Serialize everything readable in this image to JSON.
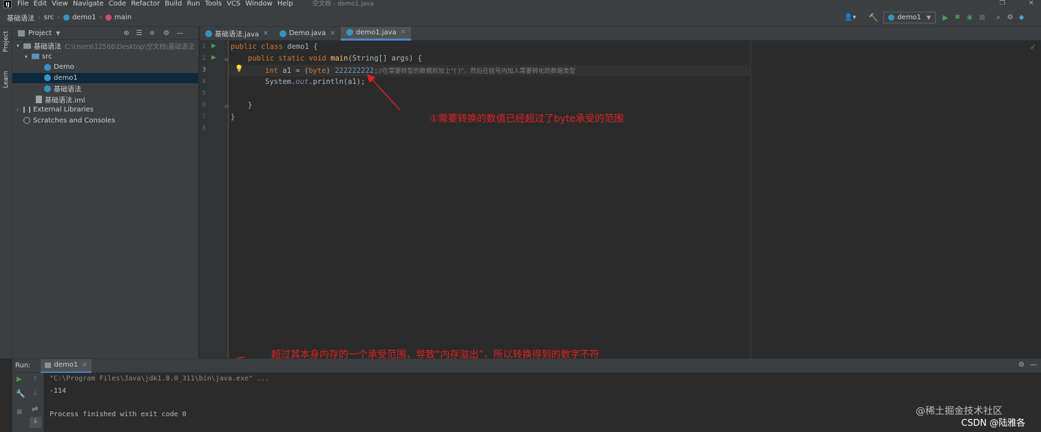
{
  "menubar": {
    "logo": "IJ",
    "items": [
      "File",
      "Edit",
      "View",
      "Navigate",
      "Code",
      "Refactor",
      "Build",
      "Run",
      "Tools",
      "VCS",
      "Window",
      "Help"
    ],
    "window_title": "空文档 - demo1.java"
  },
  "breadcrumb": {
    "items": [
      "基础语法",
      "src",
      "demo1",
      "main"
    ]
  },
  "toolbar": {
    "run_config": "demo1"
  },
  "left_strip": {
    "project": "Project",
    "learn": "Learn"
  },
  "project_panel": {
    "title": "Project",
    "tree": [
      {
        "label": "基础语法",
        "hint": "C:\\Users\\12566\\Desktop\\空文档\\基础语法"
      },
      {
        "label": "src"
      },
      {
        "label": "Demo"
      },
      {
        "label": "demo1"
      },
      {
        "label": "基础语法"
      },
      {
        "label": "基础语法.iml"
      },
      {
        "label": "External Libraries"
      },
      {
        "label": "Scratches and Consoles"
      }
    ]
  },
  "tabs": [
    {
      "label": "基础语法.java"
    },
    {
      "label": "Demo.java"
    },
    {
      "label": "demo1.java"
    }
  ],
  "editor": {
    "line_numbers": [
      "1",
      "2",
      "3",
      "4",
      "5",
      "6",
      "7",
      "8"
    ],
    "lines": {
      "l1_kw": "public class",
      "l1_rest": " demo1 {",
      "l2_kw": "public static void",
      "l2_fn": "main",
      "l2_rest": "(String[] args) {",
      "l3_kw": "int",
      "l3_mid": " a1 = (",
      "l3_kw2": "byte",
      "l3_close": ") ",
      "l3_num": "222222222",
      "l3_semi": ";",
      "l3_cmt": "//在需要转型的数据前加上“( )”，然后在括号内加入需要转化的数据类型",
      "l4_pre": "System.",
      "l4_static": "out",
      "l4_post": ".println(a1);",
      "l6": "}",
      "l7": "}"
    }
  },
  "annotations": {
    "top": "①需要转换的数值已经超过了byte承受的范围",
    "bottom": "超过其本身内存的一个承受范围，导致“内存溢出”，所以转换得到的数字不符"
  },
  "run_panel": {
    "label": "Run:",
    "tab": "demo1",
    "console": [
      "\"C:\\Program Files\\Java\\jdk1.8.0_311\\bin\\java.exe\" ...",
      "-114",
      "",
      "Process finished with exit code 0"
    ]
  },
  "watermarks": {
    "juejin": "@稀土掘金技术社区",
    "csdn": "CSDN @陆雅各"
  },
  "colors": {
    "accent": "#4a88c7",
    "annotation": "#e02020",
    "keyword": "#cc7832",
    "number": "#6897bb"
  }
}
